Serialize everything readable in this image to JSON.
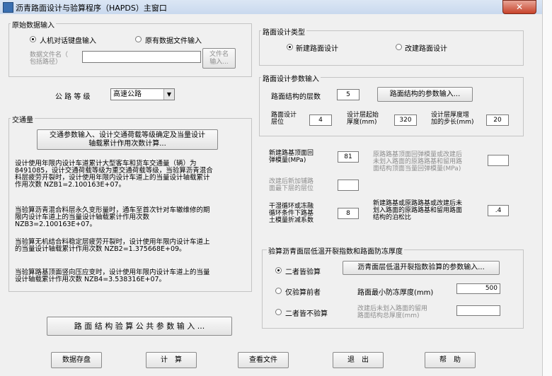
{
  "window": {
    "title": "沥青路面设计与验算程序（HAPDS）主窗口",
    "close_label": "✕"
  },
  "raw_input": {
    "legend": "原始数据输入",
    "option_manual": "人机对话键盘输入",
    "option_file": "原有数据文件输入",
    "selected": "manual",
    "filename_label_1": "数据文件名（",
    "filename_label_2": "包括路径）",
    "filename_value": "",
    "file_button_1": "文件名",
    "file_button_2": "输入..."
  },
  "road_grade": {
    "label": "公 路 等 级",
    "value": "高速公路"
  },
  "traffic": {
    "legend": "交通量",
    "button_1": "交通参数输入、设计交通荷载等级确定及当量设计",
    "button_2": "轴载累计作用次数计算...",
    "para1": [
      "设计使用年限内设计车道累计大型客车和货车交通量（辆）为",
      "8491085，设计交通荷载等级为重交通荷载等级，当验算沥青混合",
      "料层疲劳开裂时，设计使用年限内设计车道上的当量设计轴载累计",
      "作用次数  NZB1=2.100163E+07。"
    ],
    "para2": [
      "当验算沥青混合料层永久变形量时，通车至首次针对车辙维修的期",
      "限内设计车道上的当量设计轴载累计作用次数",
      "NZB3=2.100163E+07。"
    ],
    "para3": [
      "当验算无机结合料稳定层疲劳开裂时，设计使用年限内设计车道上",
      "的当量设计轴载累计作用次数  NZB2=1.375668E+09。"
    ],
    "para4": [
      "当验算路基顶面竖向压应变时，设计使用年限内设计车道上的当量",
      "设计轴载累计作用次数  NZB4=3.538316E+07。"
    ]
  },
  "common_params_button": "路 面 结 构 验 算 公 共 参 数 输 入 ...",
  "design_type": {
    "legend": "路面设计类型",
    "option_new": "新建路面设计",
    "option_rebuild": "改建路面设计",
    "selected": "new"
  },
  "design_params": {
    "legend": "路面设计参数输入",
    "layers_label": "路面结构的层数",
    "layers_value": "5",
    "structure_button": "路面结构的参数输入...",
    "design_layer_label_1": "路面设计",
    "design_layer_label_2": "层位",
    "design_layer_value": "4",
    "start_thickness_label_1": "设计层起始",
    "start_thickness_label_2": "厚度(mm)",
    "start_thickness_value": "320",
    "step_label_1": "设计层厚度增",
    "step_label_2": "加的步长(mm)",
    "step_value": "20"
  },
  "subgrade": {
    "modulus_label": [
      "新建路基顶面回",
      "弹模量(MPa)"
    ],
    "modulus_value": "81",
    "rebuild_modulus_label": [
      "原路路基顶面回弹模量或改建后",
      "未划入路面的原路路基和留用路",
      "面结构顶面当量回弹模量(MPa)"
    ],
    "rebuild_modulus_value": "",
    "new_layer_label": [
      "改建后新加铺路",
      "面最下层的层位"
    ],
    "new_layer_value": "",
    "reduction_label": [
      "干湿循环或冻融",
      "循环条件下路基",
      "土模量折减系数"
    ],
    "reduction_value": "8",
    "poisson_label": [
      "新建路基或原路路基或改建后未",
      "划入路面的原路路基和留用路面",
      "结构的泊松比"
    ],
    "poisson_value": ".4"
  },
  "crack_check": {
    "legend": "验算沥青面层低温开裂指数和路面防冻厚度",
    "option_both": "二者皆验算",
    "option_former": "仅验算前者",
    "option_none": "二者皆不验算",
    "selected": "both",
    "param_button": "沥青面层低温开裂指数验算的参数输入...",
    "min_thickness_label": "路面最小防冻厚度(mm)",
    "min_thickness_value": "500",
    "total_thickness_label": [
      "改建后未划入路面的留用",
      "路面结构总厚度(mm)"
    ],
    "total_thickness_value": ""
  },
  "bottom_buttons": {
    "save": "数据存盘",
    "compute": "计　算",
    "view_file": "查看文件",
    "exit": "退　出",
    "help": "帮　助"
  }
}
